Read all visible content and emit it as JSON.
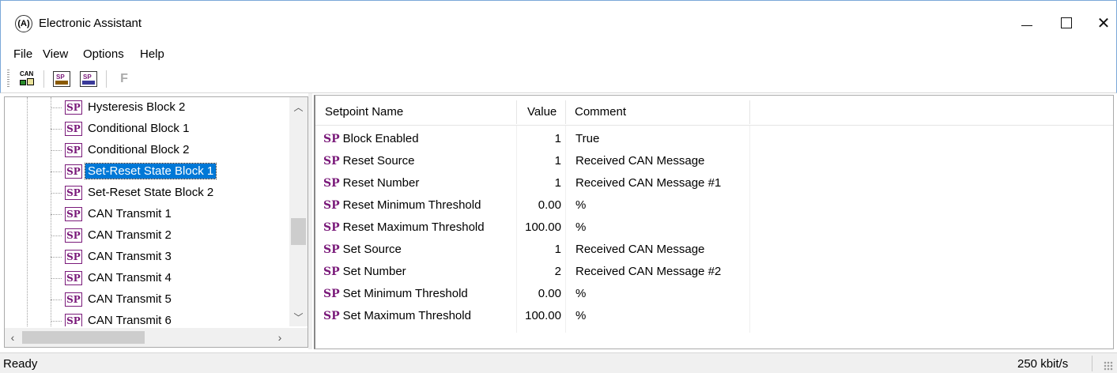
{
  "window": {
    "title": "Electronic Assistant",
    "icon": "app-logo-icon",
    "controls": [
      "minimize-icon",
      "maximize-icon",
      "close-icon"
    ]
  },
  "menu": [
    "File",
    "View",
    "Options",
    "Help"
  ],
  "toolbar": {
    "can_icon_text": "CAN",
    "sp_icon_text": "SP",
    "f_label": "F"
  },
  "tree": {
    "badge": "SP",
    "items": [
      "Hysteresis Block 2",
      "Conditional Block 1",
      "Conditional Block 2",
      "Set-Reset State Block 1",
      "Set-Reset State Block 2",
      "CAN Transmit 1",
      "CAN Transmit 2",
      "CAN Transmit 3",
      "CAN Transmit 4",
      "CAN Transmit 5",
      "CAN Transmit 6"
    ],
    "selected": "Set-Reset State Block 1"
  },
  "table": {
    "columns": [
      "Setpoint Name",
      "Value",
      "Comment"
    ],
    "sp_prefix": "SP",
    "rows": [
      {
        "name": "Block Enabled",
        "value": "1",
        "comment": "True"
      },
      {
        "name": "Reset Source",
        "value": "1",
        "comment": "Received CAN Message"
      },
      {
        "name": "Reset Number",
        "value": "1",
        "comment": "Received CAN Message #1"
      },
      {
        "name": "Reset Minimum Threshold",
        "value": "0.00",
        "comment": "%"
      },
      {
        "name": "Reset Maximum Threshold",
        "value": "100.00",
        "comment": "%"
      },
      {
        "name": "Set Source",
        "value": "1",
        "comment": "Received CAN Message"
      },
      {
        "name": "Set Number",
        "value": "2",
        "comment": "Received CAN Message #2"
      },
      {
        "name": "Set Minimum Threshold",
        "value": "0.00",
        "comment": "%"
      },
      {
        "name": "Set Maximum Threshold",
        "value": "100.00",
        "comment": "%"
      }
    ]
  },
  "status": {
    "left": "Ready",
    "right": "250 kbit/s"
  },
  "colors": {
    "selection": "#0078d7",
    "sp_badge": "#7a1a7a",
    "window_border": "#7aa7d8"
  }
}
